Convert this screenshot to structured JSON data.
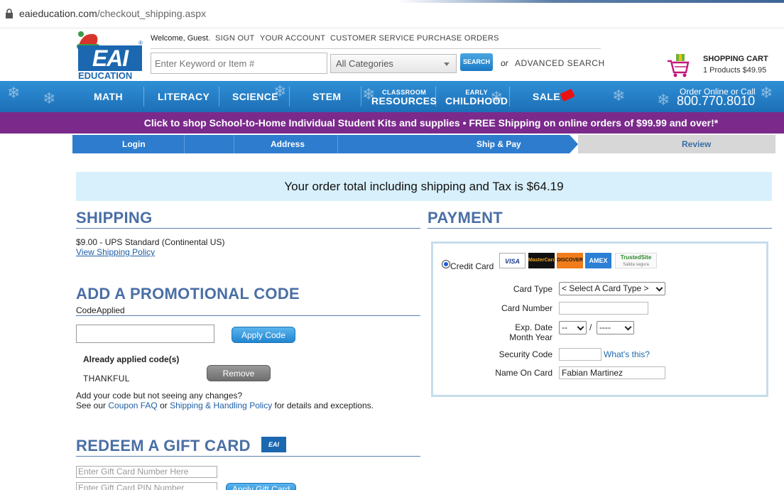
{
  "browser": {
    "url_host": "eaieducation.com",
    "url_path": "/checkout_shipping.aspx"
  },
  "header": {
    "logo_text": "EAI",
    "logo_sub": "EDUCATION",
    "welcome": "Welcome, Guest.",
    "links": [
      "SIGN OUT",
      "YOUR ACCOUNT",
      "CUSTOMER SERVICE",
      "PURCHASE ORDERS"
    ],
    "search_placeholder": "Enter Keyword or Item #",
    "category": "All Categories",
    "search_button": "SEARCH",
    "or": "or",
    "advanced_search": "ADVANCED SEARCH",
    "cart_title": "SHOPPING CART",
    "cart_summary": "1 Products $49.95"
  },
  "mainnav": {
    "items": [
      "MATH",
      "LITERACY",
      "SCIENCE",
      "STEM"
    ],
    "classroom_small": "CLASSROOM",
    "classroom_big": "RESOURCES",
    "early_small": "EARLY",
    "early_big": "CHILDHOOD",
    "sale": "SALE",
    "order_online": "Order Online or Call",
    "phone": "800.770.8010"
  },
  "promo_bar": "Click to shop School-to-Home Individual Student Kits and supplies   •   FREE Shipping on online orders of $99.99 and over!*",
  "steps": [
    "Login",
    "Address",
    "Ship & Pay",
    "Review"
  ],
  "total_banner": "Your order total including shipping and Tax is $64.19",
  "shipping": {
    "title": "SHIPPING",
    "method": "$9.00 - UPS Standard (Continental US)",
    "policy_link": "View Shipping Policy"
  },
  "promo": {
    "title": "ADD A PROMOTIONAL CODE",
    "code_applied_label": "CodeApplied",
    "apply_button": "Apply Code",
    "already_label": "Already applied code(s)",
    "applied_code": "THANKFUL",
    "remove_button": "Remove",
    "help_line1": "Add your code but not seeing any changes?",
    "help_see": "See our",
    "coupon_faq": "Coupon FAQ",
    "help_or": "or",
    "shipping_handling": "Shipping & Handling Policy",
    "help_tail": "for details and exceptions."
  },
  "gift": {
    "title": "REDEEM A GIFT CARD",
    "icon_text": "EAI",
    "number_placeholder": "Enter Gift Card Number Here",
    "pin_placeholder": "Enter Gift Card PIN Number",
    "apply_button": "Apply Gift Card"
  },
  "payment": {
    "title": "PAYMENT",
    "credit_card_label": "Credit Card",
    "cards": [
      "VISA",
      "MasterCard",
      "DISCOVER",
      "AMEX"
    ],
    "trusted_site": "TrustedSite",
    "trusted_sub": "Salida segura",
    "card_type_label": "Card Type",
    "card_type_value": "< Select A Card Type >",
    "card_number_label": "Card Number",
    "exp_label_1": "Exp. Date",
    "exp_label_2": "Month Year",
    "exp_month": "--",
    "exp_slash": "/",
    "exp_year": "----",
    "security_label": "Security Code",
    "whats_this": "What's this?",
    "name_label": "Name On Card",
    "name_value": "Fabian Martinez"
  },
  "colors": {
    "nav_blue": "#1d6fb6",
    "promo_purple": "#7b2a8c",
    "section_title": "#4a6fa5",
    "banner_bg": "#d8f0fb"
  }
}
